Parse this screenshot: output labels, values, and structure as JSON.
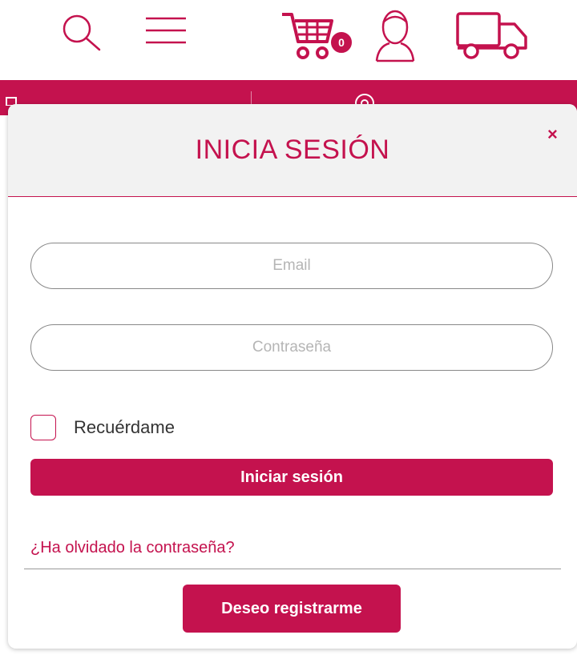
{
  "header": {
    "search_icon": "search-icon",
    "menu_icon": "menu-icon",
    "cart_icon": "cart-icon",
    "cart_count": "0",
    "user_icon": "user-icon",
    "shipping_icon": "truck-icon"
  },
  "colors": {
    "brand": "#c4124e",
    "header_bg": "#f2f2f2"
  },
  "modal": {
    "title": "INICIA SESIÓN",
    "close": "×",
    "email_placeholder": "Email",
    "password_placeholder": "Contraseña",
    "remember_label": "Recuérdame",
    "login_label": "Iniciar sesión",
    "forgot_label": "¿Ha olvidado la contraseña?",
    "register_label": "Deseo registrarme"
  }
}
